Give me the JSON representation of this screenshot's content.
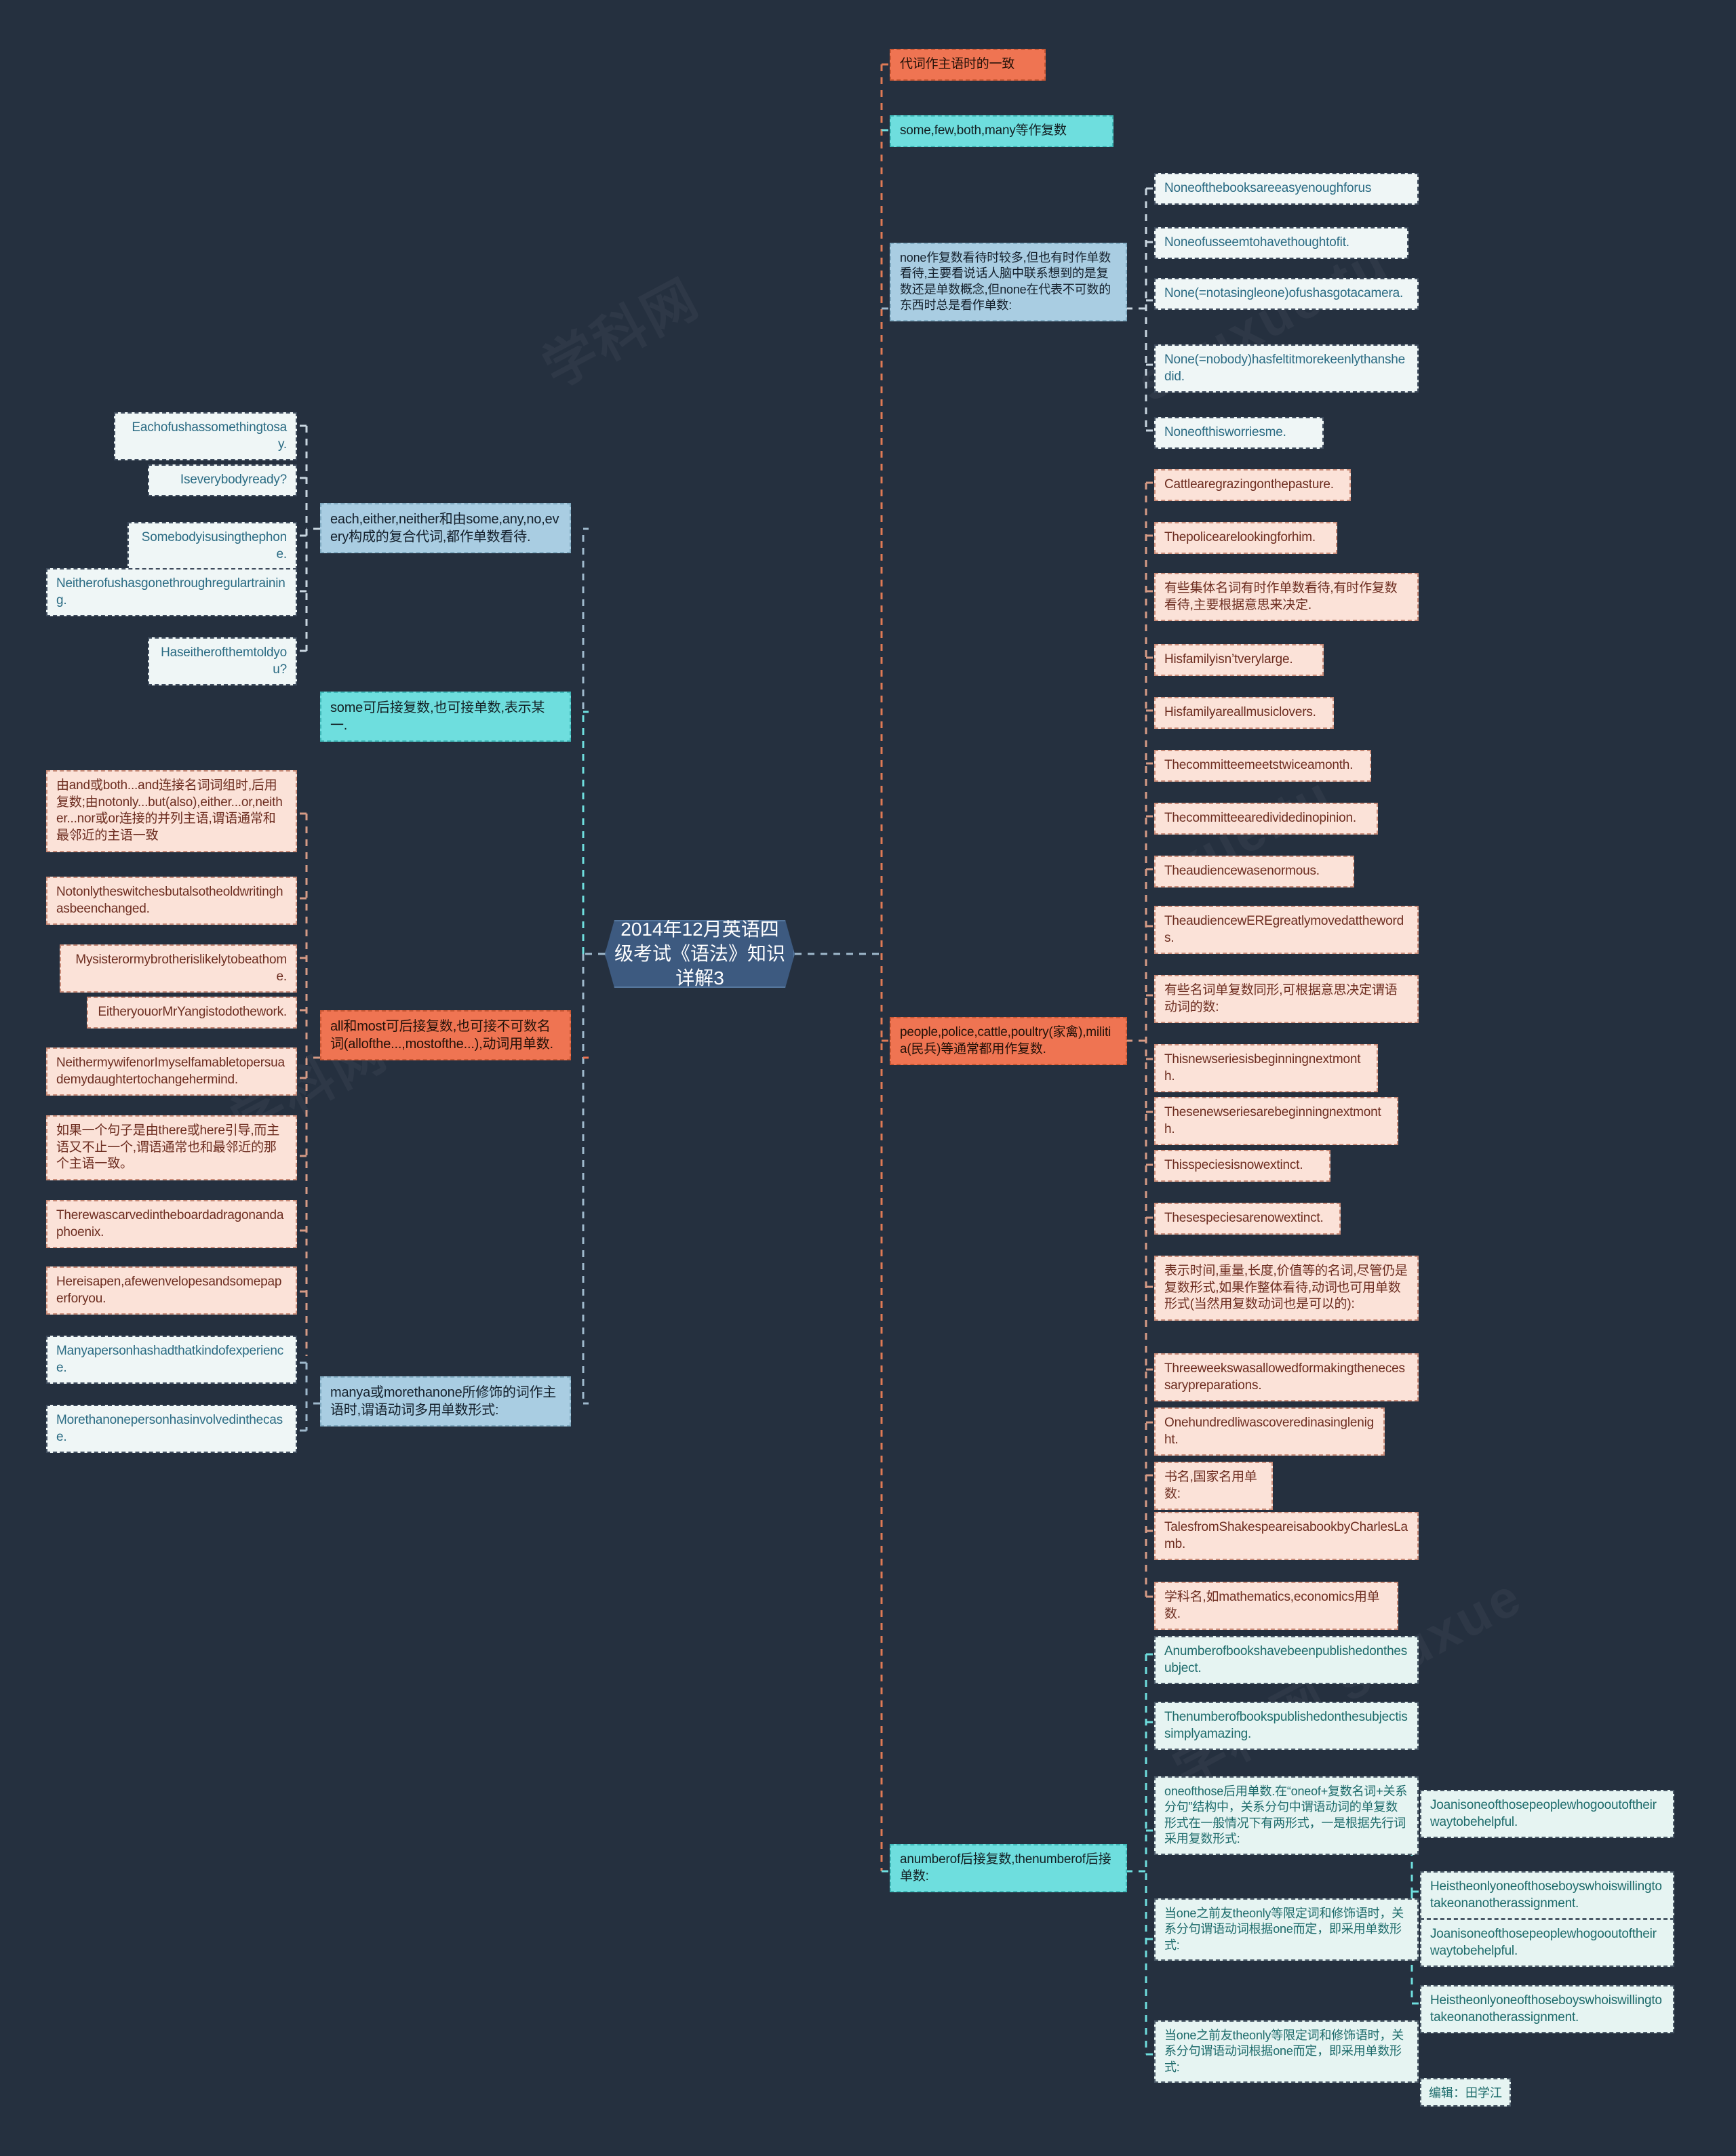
{
  "root": {
    "title": "2014年12月英语四级考试《语法》知识详解3"
  },
  "watermarks": [
    "学科网 shuxue",
    "学科网",
    "shuxue.tu",
    "学科网 shuxue"
  ],
  "left_branch": {
    "group_each": {
      "title": "each,either,neither和由some,any,no,every构成的复合代词,都作单数看待.",
      "examples": [
        "Eachofushassomethingtosay.",
        "Iseverybodyready?",
        "Somebodyisusingthephone.",
        "Neitherofushasgonethroughregulartraining.",
        "Haseitherofthemtoldyou?"
      ]
    },
    "group_some": {
      "title": "some可后接复数,也可接单数,表示某一."
    },
    "group_all_most": {
      "title": "all和most可后接复数,也可接不可数名词(allofthe...,mostofthe...),动词用单数.",
      "examples": [
        "由and或both...and连接名词词组时,后用复数;由notonly...but(also),either...or,neither...nor或or连接的并列主语,谓语通常和最邻近的主语一致",
        "Notonlytheswitchesbutalsotheoldwritinghasbeenchanged.",
        "Mysisterormybrotherislikelytobeathome.",
        "EitheryouorMrYangistodothework.",
        "NeithermywifenorImyselfamabletopersuademydaughtertochangehermind.",
        "如果一个句子是由there或here引导,而主语又不止一个,谓语通常也和最邻近的那个主语一致。",
        "Therewascarvedintheboardadragonandaphoenix.",
        "Hereisapen,afewenvelopesandsomepaperforyou."
      ]
    },
    "group_manya": {
      "title": "manya或morethanone所修饰的词作主语时,谓语动词多用单数形式:",
      "examples": [
        "Manyapersonhashadthatkindofexperience.",
        "Morethanonepersonhasinvolvedinthecase."
      ]
    }
  },
  "right_branch": {
    "headers": [
      {
        "label": "代词作主语时的一致",
        "color": "orange"
      },
      {
        "label": "some,few,both,many等作复数",
        "color": "cyan"
      }
    ],
    "group_none": {
      "title": "none作复数看待时较多,但也有时作单数看待,主要看说话人脑中联系想到的是复数还是单数概念,但none在代表不可数的东西时总是看作单数:",
      "examples": [
        "Noneofthebooksareeasyenoughforus",
        "Noneofusseemtohavethoughtofit.",
        "None(=notasingleone)ofushasgotacamera.",
        "None(=nobody)hasfeltitmorekeenlythanshedid.",
        "Noneofthisworriesme."
      ]
    },
    "group_people": {
      "title": "people,police,cattle,poultry(家禽),militia(民兵)等通常都用作复数.",
      "examples": [
        "Cattlearegrazingonthepasture.",
        "Thepolicearelookingforhim.",
        "有些集体名词有时作单数看待,有时作复数看待,主要根据意思来决定.",
        "Hisfamilyisn’tverylarge.",
        "Hisfamilyareallmusiclovers.",
        "Thecommitteemeetstwiceamonth.",
        "Thecommitteearedividedinopinion.",
        "Theaudiencewasenormous.",
        "TheaudiencewEREgreatlymovedatthewords.",
        "有些名词单复数同形,可根据意思决定谓语动词的数:",
        "Thisnewseriesisbeginningnextmonth.",
        "Thesenewseriesarebeginningnextmonth.",
        "Thisspeciesisnowextinct.",
        "Thesespeciesarenowextinct.",
        "表示时间,重量,长度,价值等的名词,尽管仍是复数形式,如果作整体看待,动词也可用单数形式(当然用复数动词也是可以的):",
        "Threeweekswasallowedformakingthenecessarypreparations.",
        "Onehundredliwascoveredinasinglenight.",
        "书名,国家名用单数:",
        "TalesfromShakespeareisabookbyCharlesLamb.",
        "学科名,如mathematics,economics用单数."
      ]
    },
    "group_anumberof": {
      "title": "anumberof后接复数,thenumberof后接单数:",
      "children": [
        {
          "text": "Anumberofbookshavebeenpublishedonthesubject.",
          "kids": []
        },
        {
          "text": "Thenumberofbookspublishedonthesubjectissimplyamazing.",
          "kids": []
        },
        {
          "text": "oneofthose后用单数.在“oneof+复数名词+关系分句”结构中，关系分句中谓语动词的单复数形式在一般情况下有两形式，一是根据先行词采用复数形式:",
          "kids": [
            "Joanisoneofthosepeoplewhogooutoftheirwaytobehelpful.",
            "Heistheonlyoneofthoseboyswhoiswillingtotakeonanotherassignment."
          ]
        },
        {
          "text": "当one之前友theonly等限定词和修饰语时，关系分句谓语动词根据one而定，即采用单数形式:",
          "kids": [
            "Joanisoneofthosepeoplewhogooutoftheirwaytobehelpful.",
            "Heistheonlyoneofthoseboyswhoiswillingtotakeonanotherassignment."
          ]
        },
        {
          "text": "当one之前友theonly等限定词和修饰语时，关系分句谓语动词根据one而定，即采用单数形式:",
          "kids": []
        }
      ]
    },
    "credit": "编辑：田学江"
  }
}
